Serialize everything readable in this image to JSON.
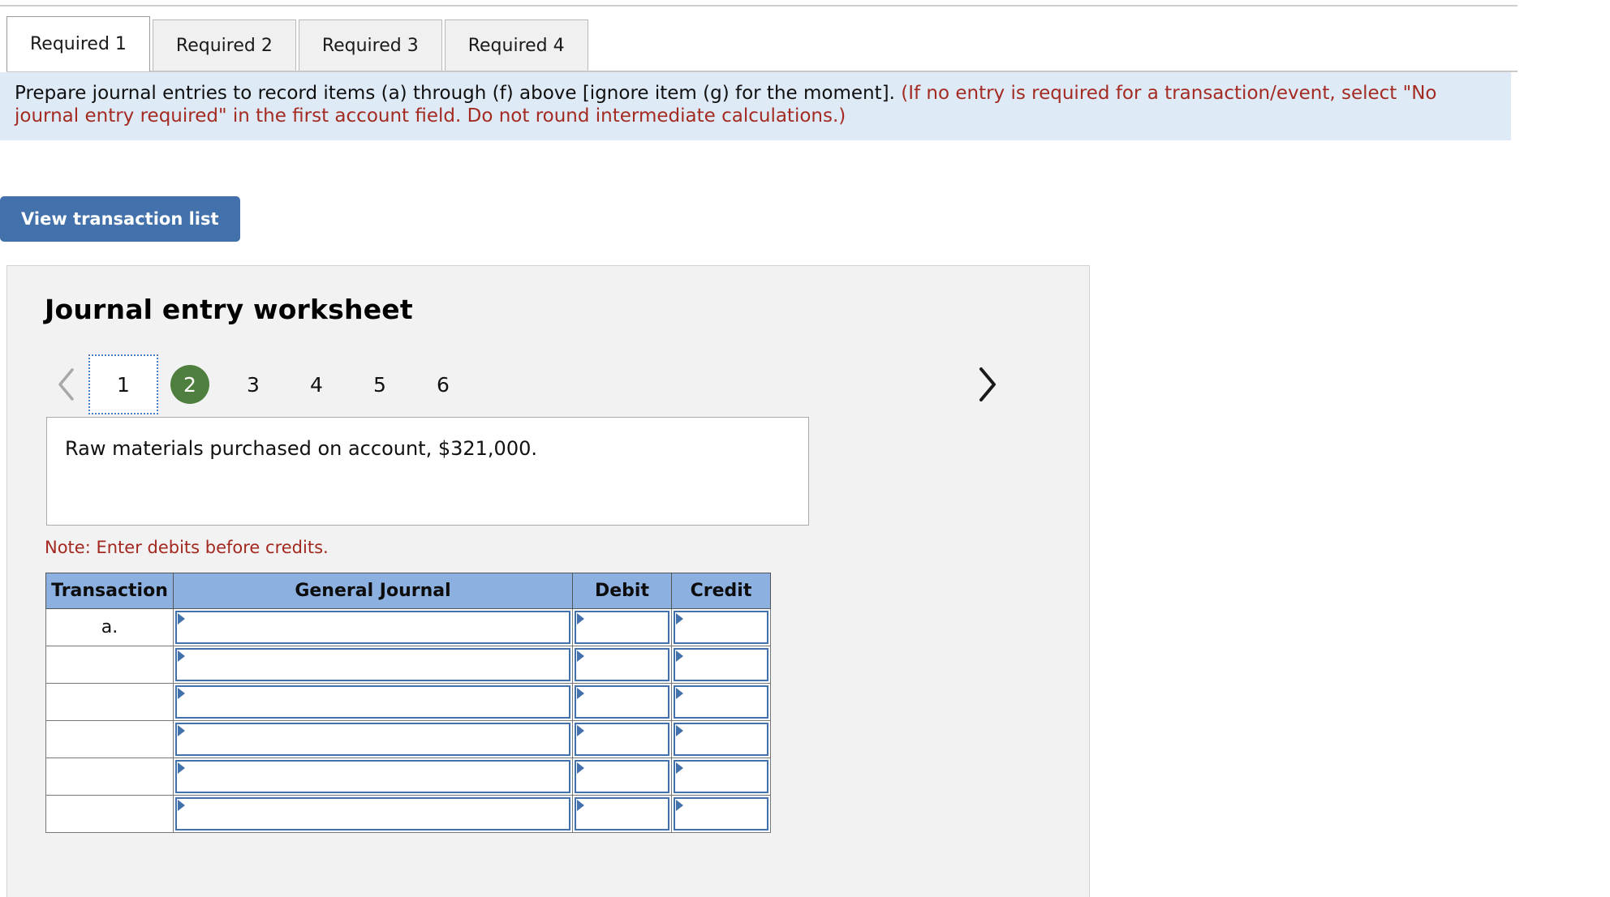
{
  "tabs": [
    {
      "label": "Required 1",
      "active": true
    },
    {
      "label": "Required 2",
      "active": false
    },
    {
      "label": "Required 3",
      "active": false
    },
    {
      "label": "Required 4",
      "active": false
    }
  ],
  "banner": {
    "main": "Prepare journal entries to record items (a) through (f) above [ignore item (g) for the moment].",
    "hint": "(If no entry is required for a transaction/event, select \"No journal entry required\" in the first account field. Do not round intermediate calculations.)"
  },
  "toolbar": {
    "view_transaction_list_label": "View transaction list"
  },
  "worksheet": {
    "title": "Journal entry worksheet",
    "pager": {
      "prev_icon": "chevron-left-icon",
      "next_icon": "chevron-right-icon",
      "pages": [
        "1",
        "2",
        "3",
        "4",
        "5",
        "6"
      ],
      "focused_page": "1",
      "current_page": "2"
    },
    "transaction_text": "Raw materials purchased on account, $321,000.",
    "note": "Note: Enter debits before credits.",
    "table": {
      "headers": [
        "Transaction",
        "General Journal",
        "Debit",
        "Credit"
      ],
      "rows": [
        {
          "transaction": "a.",
          "general_journal": "",
          "debit": "",
          "credit": ""
        },
        {
          "transaction": "",
          "general_journal": "",
          "debit": "",
          "credit": ""
        },
        {
          "transaction": "",
          "general_journal": "",
          "debit": "",
          "credit": ""
        },
        {
          "transaction": "",
          "general_journal": "",
          "debit": "",
          "credit": ""
        },
        {
          "transaction": "",
          "general_journal": "",
          "debit": "",
          "credit": ""
        },
        {
          "transaction": "",
          "general_journal": "",
          "debit": "",
          "credit": ""
        }
      ]
    }
  },
  "colors": {
    "banner_bg": "#dfeaf7",
    "hint_red": "#a32b21",
    "button_blue": "#4371ab",
    "header_blue": "#8cb0df",
    "current_page_green": "#4f7f3f"
  }
}
